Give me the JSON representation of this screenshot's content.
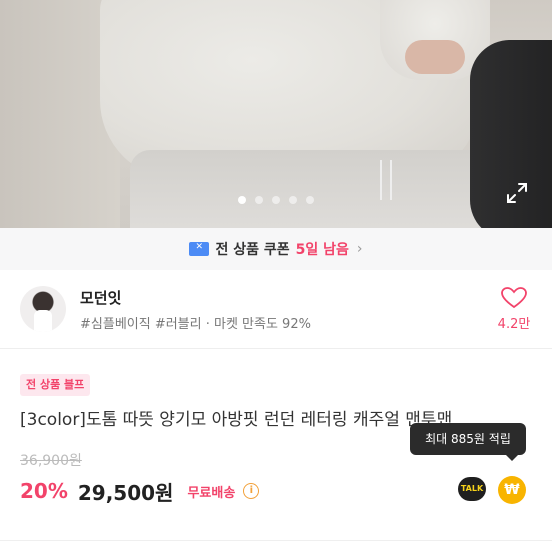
{
  "gallery": {
    "slide_count": 5,
    "active_index": 0
  },
  "coupon_bar": {
    "text": "전 상품 쿠폰",
    "days_left": "5일 남음",
    "chevron": "›"
  },
  "shop": {
    "name": "모던잇",
    "tags": "#심플베이직 #러블리 · 마켓 만족도 92%",
    "likes": "4.2만"
  },
  "product": {
    "badge": "전 상품 블프",
    "title": "[3color]도톰 따뜻 양기모 아방핏 런던 레터링 캐주얼 맨투맨",
    "original_price": "36,900원",
    "discount": "20%",
    "price": "29,500원",
    "shipping": "무료배송",
    "info_icon": "i",
    "points_tooltip": "최대 885원 적립"
  },
  "actions": {
    "talk_label": "TALK",
    "coin_label": "₩"
  },
  "colors": {
    "accent": "#f2436a",
    "coupon_blue": "#4c8bf5",
    "coin": "#f8b400"
  }
}
